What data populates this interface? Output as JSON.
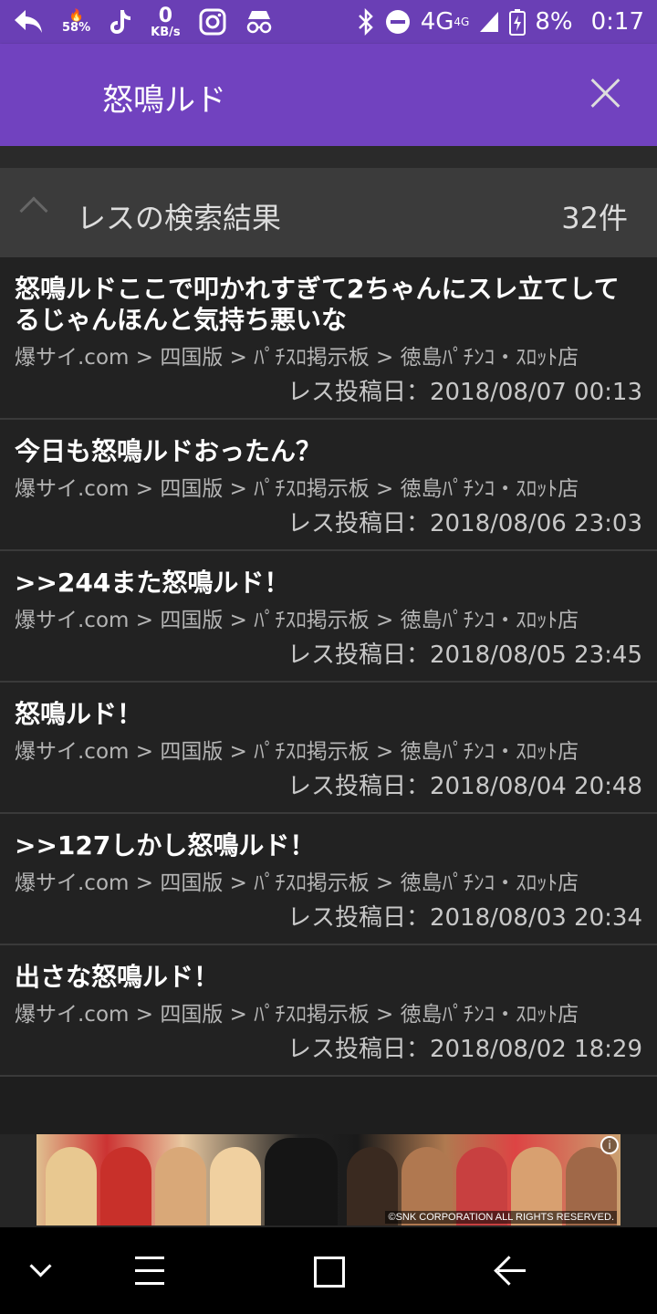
{
  "status_bar": {
    "battery_saver_percent": "58%",
    "speed_value": "0",
    "speed_unit": "KB/s",
    "network": "4G",
    "network_small": "4G",
    "battery": "8%",
    "time": "0:17",
    "left_icons": [
      "reply-icon",
      "flame-icon",
      "tiktok-icon",
      "speed-meter",
      "instagram-icon",
      "incognito-icon"
    ],
    "right_icons": [
      "bluetooth-icon",
      "dnd-icon",
      "signal-icon",
      "battery-charging-icon"
    ]
  },
  "app_bar": {
    "title": "怒鳴ルド",
    "background": "#7142bf"
  },
  "section": {
    "title": "レスの検索結果",
    "count": "32件"
  },
  "results": [
    {
      "title": "怒鳴ルドここで叩かれすぎて2ちゃんにスレ立てしてるじゃんほんと気持ち悪いな",
      "path": "爆サイ.com > 四国版 > ﾊﾟﾁｽﾛ掲示板 > 徳島ﾊﾟﾁﾝｺ・ｽﾛｯﾄ店",
      "date": "レス投稿日：2018/08/07 00:13"
    },
    {
      "title": "今日も怒鳴ルドおったん？",
      "path": "爆サイ.com > 四国版 > ﾊﾟﾁｽﾛ掲示板 > 徳島ﾊﾟﾁﾝｺ・ｽﾛｯﾄ店",
      "date": "レス投稿日：2018/08/06 23:03"
    },
    {
      "title": ">>244また怒鳴ルド！",
      "path": "爆サイ.com > 四国版 > ﾊﾟﾁｽﾛ掲示板 > 徳島ﾊﾟﾁﾝｺ・ｽﾛｯﾄ店",
      "date": "レス投稿日：2018/08/05 23:45"
    },
    {
      "title": "怒鳴ルド！",
      "path": "爆サイ.com > 四国版 > ﾊﾟﾁｽﾛ掲示板 > 徳島ﾊﾟﾁﾝｺ・ｽﾛｯﾄ店",
      "date": "レス投稿日：2018/08/04 20:48"
    },
    {
      "title": ">>127しかし怒鳴ルド！",
      "path": "爆サイ.com > 四国版 > ﾊﾟﾁｽﾛ掲示板 > 徳島ﾊﾟﾁﾝｺ・ｽﾛｯﾄ店",
      "date": "レス投稿日：2018/08/03 20:34"
    },
    {
      "title": "出さな怒鳴ルド！",
      "path": "爆サイ.com > 四国版 > ﾊﾟﾁｽﾛ掲示板 > 徳島ﾊﾟﾁﾝｺ・ｽﾛｯﾄ店",
      "date": "レス投稿日：2018/08/02 18:29"
    }
  ],
  "ad": {
    "copyright": "©SNK CORPORATION ALL RIGHTS RESERVED.",
    "info_icon": "info-icon"
  },
  "nav_bar": {
    "icons": [
      "chevron-down-icon",
      "menu-icon",
      "home-square-icon",
      "back-arrow-icon"
    ]
  }
}
